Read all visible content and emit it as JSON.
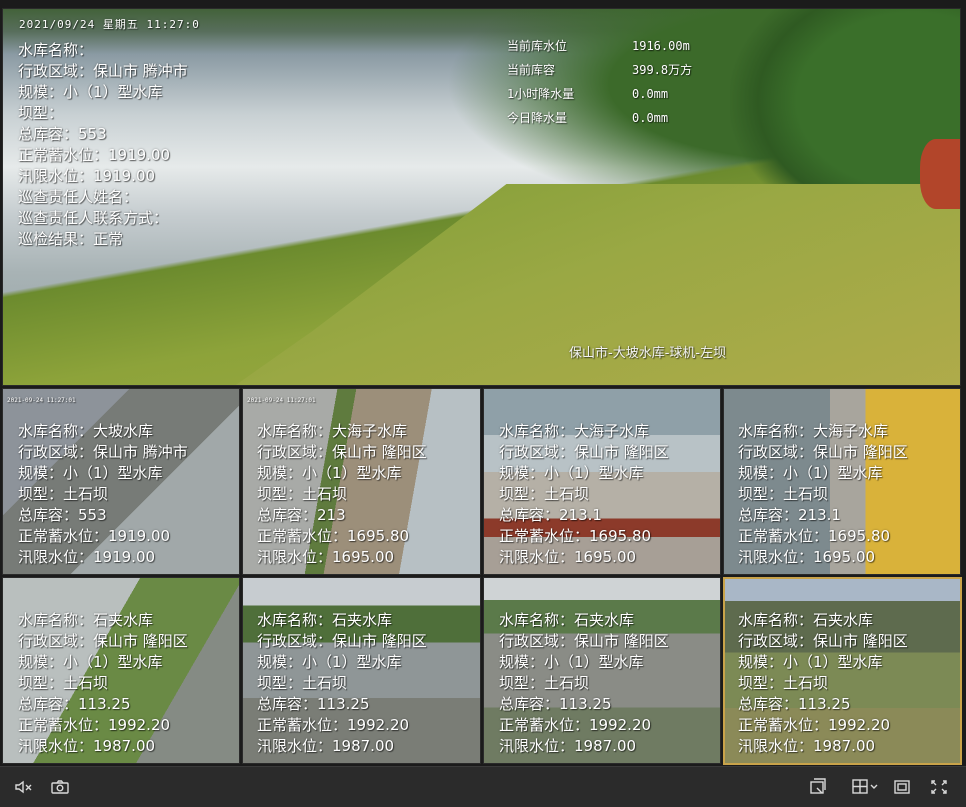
{
  "main": {
    "timestamp": "2021/09/24 星期五 11:27:0",
    "info": [
      "水库名称：",
      "行政区域：保山市 腾冲市",
      "规模：小（1）型水库",
      "坝型：",
      "总库容：553",
      "正常蓄水位：1919.00",
      "汛限水位：1919.00",
      "巡查责任人姓名：",
      "巡查责任人联系方式：",
      "巡检结果：正常"
    ],
    "stats": [
      {
        "label": "当前库水位",
        "value": "1916.00m"
      },
      {
        "label": "当前库容",
        "value": "399.8万方"
      },
      {
        "label": "1小时降水量",
        "value": "0.0mm"
      },
      {
        "label": "今日降水量",
        "value": "0.0mm"
      }
    ],
    "caption": "保山市-大坡水库-球机-左坝"
  },
  "cells": [
    {
      "timestamp": "2021-09-24 11:27:01",
      "info": [
        "水库名称：大坡水库",
        "行政区域：保山市 腾冲市",
        "规模：小（1）型水库",
        "坝型：土石坝",
        "总库容：553",
        "正常蓄水位：1919.00",
        "汛限水位：1919.00"
      ]
    },
    {
      "timestamp": "2021-09-24 11:27:01",
      "info": [
        "水库名称：大海子水库",
        "行政区域：保山市 隆阳区",
        "规模：小（1）型水库",
        "坝型：土石坝",
        "总库容：213",
        "正常蓄水位：1695.80",
        "汛限水位：1695.00"
      ]
    },
    {
      "timestamp": "",
      "info": [
        "水库名称：大海子水库",
        "行政区域：保山市 隆阳区",
        "规模：小（1）型水库",
        "坝型：土石坝",
        "总库容：213.1",
        "正常蓄水位：1695.80",
        "汛限水位：1695.00"
      ]
    },
    {
      "timestamp": "",
      "info": [
        "水库名称：大海子水库",
        "行政区域：保山市 隆阳区",
        "规模：小（1）型水库",
        "坝型：土石坝",
        "总库容：213.1",
        "正常蓄水位：1695.80",
        "汛限水位：1695.00"
      ]
    },
    {
      "timestamp": "",
      "info": [
        "水库名称：石夹水库",
        "行政区域：保山市 隆阳区",
        "规模：小（1）型水库",
        "坝型：土石坝",
        "总库容：113.25",
        "正常蓄水位：1992.20",
        "汛限水位：1987.00"
      ]
    },
    {
      "timestamp": "",
      "info": [
        "水库名称：石夹水库",
        "行政区域：保山市 隆阳区",
        "规模：小（1）型水库",
        "坝型：土石坝",
        "总库容：113.25",
        "正常蓄水位：1992.20",
        "汛限水位：1987.00"
      ]
    },
    {
      "timestamp": "",
      "info": [
        "水库名称：石夹水库",
        "行政区域：保山市 隆阳区",
        "规模：小（1）型水库",
        "坝型：土石坝",
        "总库容：113.25",
        "正常蓄水位：1992.20",
        "汛限水位：1987.00"
      ]
    },
    {
      "timestamp": "",
      "info": [
        "水库名称：石夹水库",
        "行政区域：保山市 隆阳区",
        "规模：小（1）型水库",
        "坝型：土石坝",
        "总库容：113.25",
        "正常蓄水位：1992.20",
        "汛限水位：1987.00"
      ]
    }
  ],
  "toolbar": {
    "left_icons": [
      "mute-icon",
      "camera-icon"
    ],
    "right_icons": [
      "screenshot-icon",
      "layout-icon",
      "window-icon",
      "fullscreen-icon"
    ],
    "colors": {
      "background": "#2b2b2b",
      "icon": "#d9d9d9",
      "active_border": "#c9a34a"
    }
  }
}
